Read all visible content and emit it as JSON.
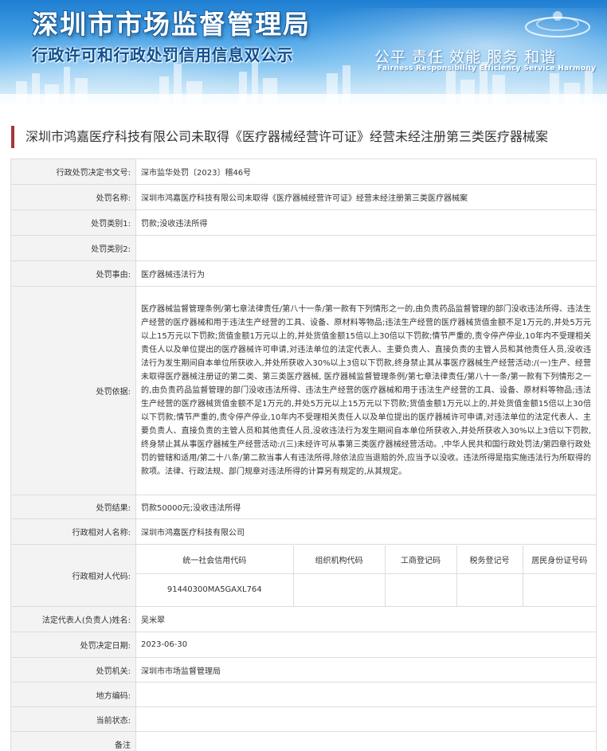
{
  "header": {
    "title": "深圳市市场监督管理局",
    "subtitle": "行政许可和行政处罚信用信息双公示",
    "motto": "公平 责任 效能 服务 和谐",
    "motto_en": "Fairness Responsibility Efficiency Service Harmony"
  },
  "case_title": "深圳市鸿嘉医疗科技有限公司未取得《医疗器械经营许可证》经营未经注册第三类医疗器械案",
  "fields": {
    "decision_no": {
      "label": "行政处罚决定书文号:",
      "value": "深市监华处罚〔2023〕稽46号"
    },
    "penalty_name": {
      "label": "处罚名称:",
      "value": "深圳市鸿嘉医疗科技有限公司未取得《医疗器械经营许可证》经营未经注册第三类医疗器械案"
    },
    "category1": {
      "label": "处罚类别1:",
      "value": "罚款;没收违法所得"
    },
    "category2": {
      "label": "处罚类别2:",
      "value": ""
    },
    "reason": {
      "label": "处罚事由:",
      "value": "医疗器械违法行为"
    },
    "basis": {
      "label": "处罚依据:",
      "value": "医疗器械监督管理条例/第七章法律责任/第八十一条/第一款有下列情形之一的,由负责药品监督管理的部门没收违法所得、违法生产经营的医疗器械和用于违法生产经营的工具、设备、原材料等物品;违法生产经营的医疗器械货值金额不足1万元的,并处5万元以上15万元以下罚款;货值金额1万元以上的,并处货值金额15倍以上30倍以下罚款;情节严重的,责令停产停业,10年内不受理相关责任人以及单位提出的医疗器械许可申请,对违法单位的法定代表人、主要负责人、直接负责的主管人员和其他责任人员,没收违法行为发生期间自本单位所获收入,并处所获收入30%以上3倍以下罚款,终身禁止其从事医疗器械生产经营活动:/(一)生产、经营未取得医疗器械注册证的第二类、第三类医疗器械, 医疗器械监督管理条例/第七章法律责任/第八十一条/第一款有下列情形之一的,由负责药品监督管理的部门没收违法所得、违法生产经营的医疗器械和用于违法生产经营的工具、设备、原材料等物品;违法生产经营的医疗器械货值金额不足1万元的,并处5万元以上15万元以下罚款;货值金额1万元以上的,并处货值金额15倍以上30倍以下罚款;情节严重的,责令停产停业,10年内不受理相关责任人以及单位提出的医疗器械许可申请,对违法单位的法定代表人、主要负责人、直接负责的主管人员和其他责任人员,没收违法行为发生期间自本单位所获收入,并处所获收入30%以上3倍以下罚款,终身禁止其从事医疗器械生产经营活动:/(三)未经许可从事第三类医疗器械经营活动。,中华人民共和国行政处罚法/第四章行政处罚的管辖和适用/第二十八条/第二款当事人有违法所得,除依法应当退赔的外,应当予以没收。违法所得是指实施违法行为所取得的款项。法律、行政法规、部门规章对违法所得的计算另有规定的,从其规定。"
    },
    "result": {
      "label": "处罚结果:",
      "value": "罚款50000元;没收违法所得"
    },
    "party_name": {
      "label": "行政相对人名称:",
      "value": "深圳市鸿嘉医疗科技有限公司"
    },
    "party_code": {
      "label": "行政相对人代码:",
      "headers": [
        "统一社会信用代码",
        "组织机构代码",
        "工商登记码",
        "税务登记号",
        "居民身份证号码"
      ],
      "values": [
        "91440300MA5GAXL764",
        "",
        "",
        "",
        ""
      ]
    },
    "legal_rep": {
      "label": "法定代表人(负责人)姓名:",
      "value": "吴米翠"
    },
    "decision_date": {
      "label": "处罚决定日期:",
      "value": "2023-06-30"
    },
    "authority": {
      "label": "处罚机关:",
      "value": "深圳市市场监督管理局"
    },
    "region_code": {
      "label": "地方编码:",
      "value": ""
    },
    "status": {
      "label": "当前状态:",
      "value": ""
    },
    "remark": {
      "label": "备注",
      "value": ""
    }
  },
  "colors": {
    "accent_bar": "#a9353a",
    "label_bg": "#f3f3f3",
    "border": "#dddddd",
    "banner_top": "#1f7ed1"
  }
}
